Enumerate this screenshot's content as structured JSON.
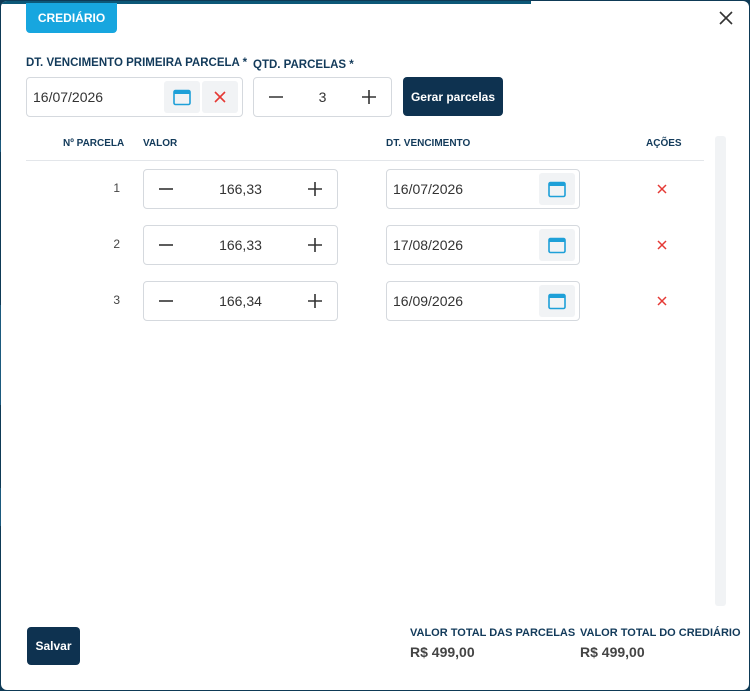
{
  "header": {
    "tab_label": "CREDIÁRIO"
  },
  "form": {
    "first_due_label": "DT. VENCIMENTO PRIMEIRA PARCELA *",
    "first_due_value": "16/07/2026",
    "qty_label": "QTD. PARCELAS *",
    "qty_value": "3",
    "generate_button": "Gerar parcelas"
  },
  "table": {
    "columns": [
      "Nº PARCELA",
      "VALOR",
      "DT. VENCIMENTO",
      "AÇÕES"
    ],
    "rows": [
      {
        "number": "1",
        "value": "166,33",
        "due_date": "16/07/2026"
      },
      {
        "number": "2",
        "value": "166,33",
        "due_date": "17/08/2026"
      },
      {
        "number": "3",
        "value": "166,34",
        "due_date": "16/09/2026"
      }
    ]
  },
  "footer": {
    "save_button": "Salvar",
    "total_installments_label": "VALOR TOTAL DAS PARCELAS",
    "total_installments_value": "R$ 499,00",
    "total_credit_label": "VALOR TOTAL DO CREDIÁRIO",
    "total_credit_value": "R$ 499,00"
  },
  "colors": {
    "accent": "#17a6df",
    "primary": "#0e3250",
    "danger": "#e53935",
    "calendar": "#1ea0d8"
  },
  "icons": [
    "close-icon",
    "calendar-icon",
    "clear-icon",
    "minus-icon",
    "plus-icon",
    "delete-icon"
  ]
}
